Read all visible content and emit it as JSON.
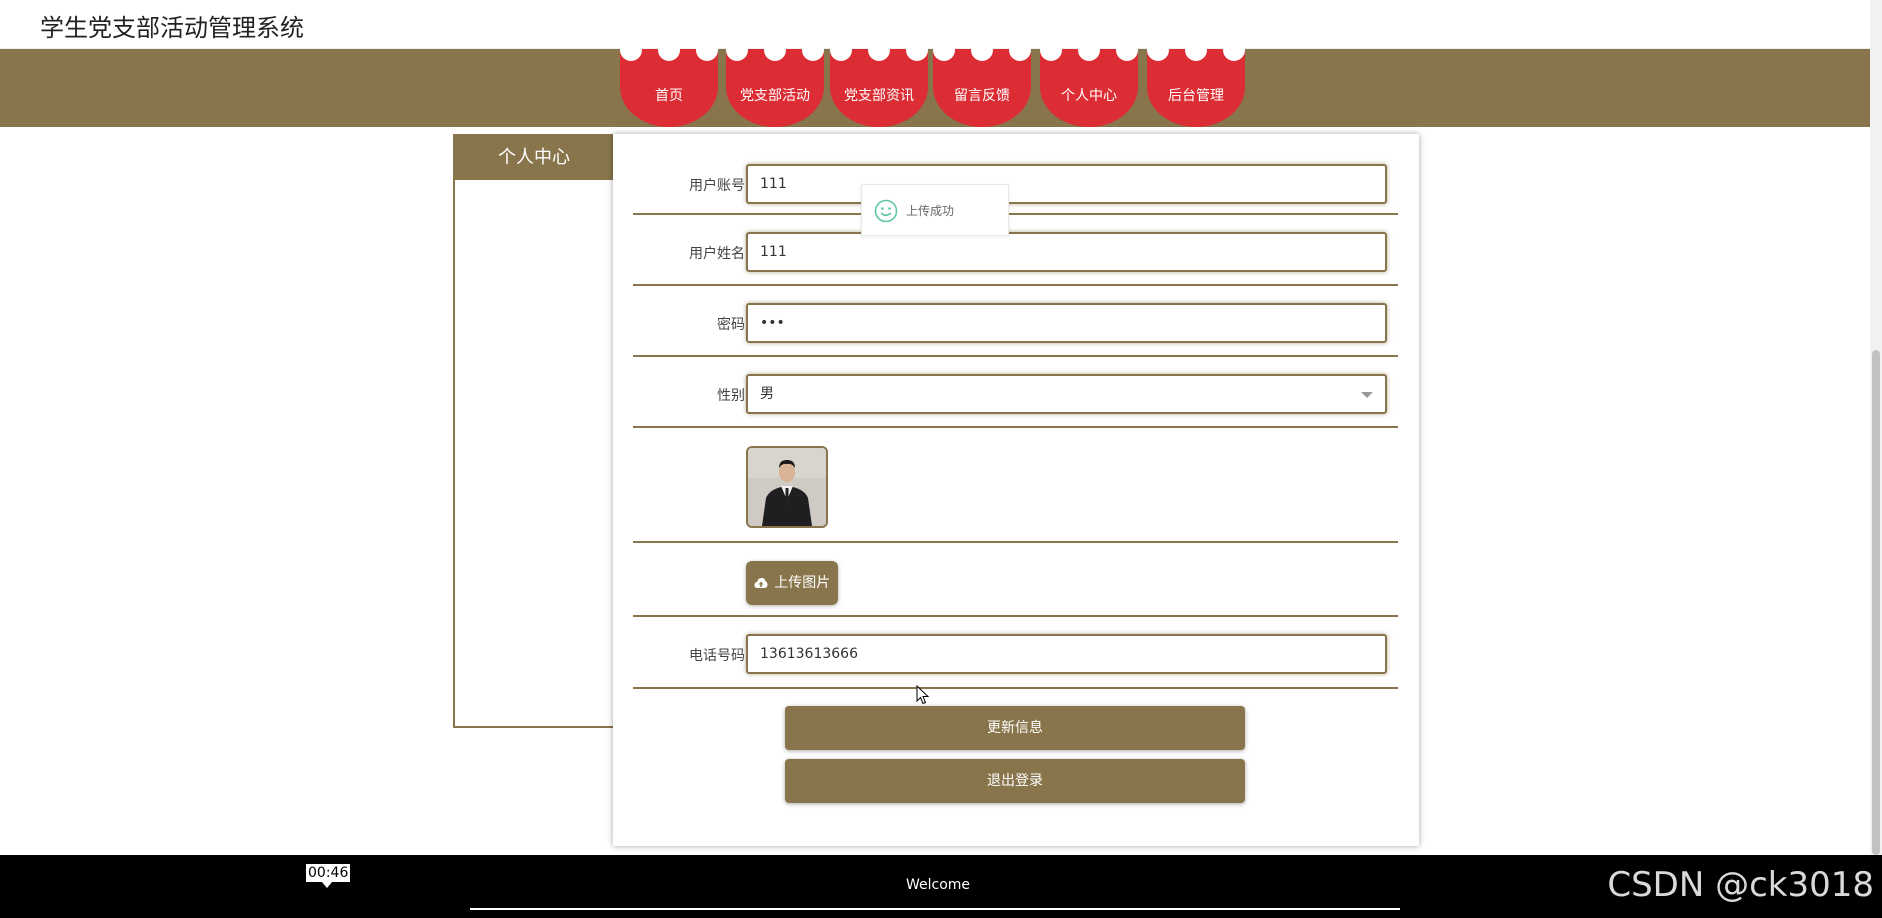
{
  "header": {
    "title": "学生党支部活动管理系统"
  },
  "nav": {
    "items": [
      {
        "label": "首页"
      },
      {
        "label": "党支部活动"
      },
      {
        "label": "党支部资讯"
      },
      {
        "label": "留言反馈"
      },
      {
        "label": "个人中心"
      },
      {
        "label": "后台管理"
      }
    ]
  },
  "sidebar": {
    "title": "个人中心"
  },
  "form": {
    "account_label": "用户账号",
    "account_value": "111",
    "name_label": "用户姓名",
    "name_value": "111",
    "password_label": "密码",
    "password_value": "•••",
    "gender_label": "性别",
    "gender_value": "男",
    "upload_label": "上传图片",
    "phone_label": "电话号码",
    "phone_value": "13613613666",
    "update_button": "更新信息",
    "logout_button": "退出登录"
  },
  "toast": {
    "message": "上传成功"
  },
  "bottom": {
    "timer": "00:46",
    "welcome": "Welcome",
    "watermark": "CSDN @ck3018"
  },
  "colors": {
    "brand": "#88754b",
    "nav_red": "#dc2c34",
    "toast_green": "#5fc6a0"
  }
}
